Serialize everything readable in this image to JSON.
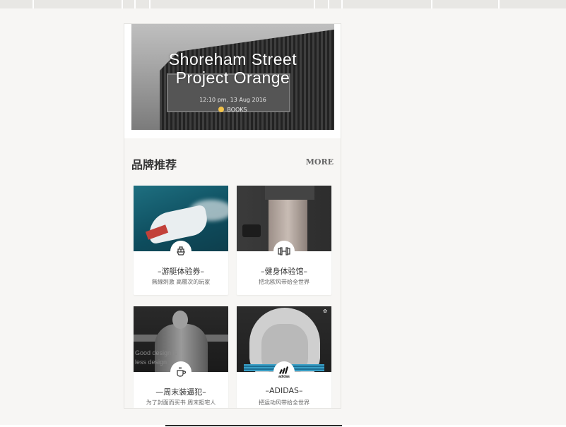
{
  "hero": {
    "title_line1": "Shoreham Street",
    "title_line2": "Project Orange",
    "time": "12:10 pm, 13 Aug 2016",
    "tag": "BOOKS",
    "tag_color": "#f3c34a"
  },
  "section": {
    "title": "品牌推荐",
    "more_label": "MORE"
  },
  "cards": [
    {
      "name": "–游艇体验券–",
      "desc": "無線刺激 高層次的玩家",
      "icon": "ship-icon"
    },
    {
      "name": "–健身体验馆–",
      "desc": "把北欧风带给全世界",
      "icon": "dumbbell-icon"
    },
    {
      "name": "—周末装逼犯–",
      "desc": "为了封面而买书 周末拒宅人",
      "icon": "coffee-cup-icon",
      "image_text_line1": "Good design is",
      "image_text_line2": "less design"
    },
    {
      "name": "–ADIDAS–",
      "desc": "把运动风带给全世界",
      "icon": "adidas-logo",
      "logo_text": "adidas"
    }
  ]
}
